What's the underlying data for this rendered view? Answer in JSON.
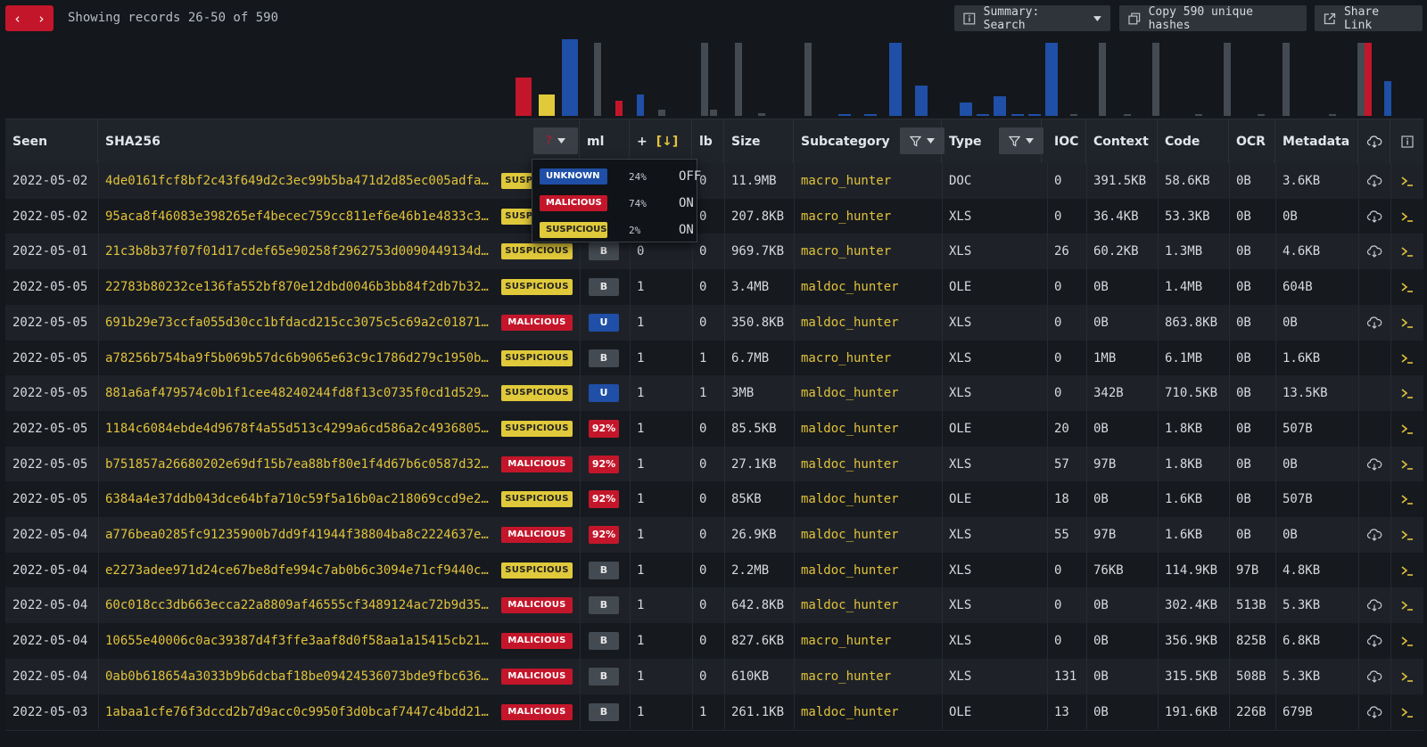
{
  "nav": {
    "prev": "‹",
    "next": "›"
  },
  "records_text": "Showing records 26-50 of 590",
  "toolbar": {
    "summary_label": "Summary: Search",
    "copy_label": "Copy 590 unique hashes",
    "share_label": "Share Link"
  },
  "colors": {
    "suspicious": "#e0c93a",
    "malicious": "#c4162a",
    "unknown": "#1f4fa6",
    "benign": "#444a52",
    "hash_text": "#e1c23c"
  },
  "columns": {
    "seen": "Seen",
    "sha256": "SHA256",
    "verdict_filter": "?",
    "ml": "ml",
    "plus": "+",
    "sort": "[↓]",
    "lb": "lb",
    "size": "Size",
    "subcategory": "Subcategory",
    "type": "Type",
    "ioc": "IOC",
    "context": "Context",
    "code": "Code",
    "ocr": "OCR",
    "metadata": "Metadata"
  },
  "verdict_popup": [
    {
      "label": "UNKNOWN",
      "percent": "24%",
      "state": "OFF",
      "color": "unknown"
    },
    {
      "label": "MALICIOUS",
      "percent": "74%",
      "state": "ON",
      "color": "malicious"
    },
    {
      "label": "SUSPICIOUS",
      "percent": "2%",
      "state": "ON",
      "color": "suspicious"
    }
  ],
  "rows": [
    {
      "seen": "2022-05-02",
      "hash": "4de0161fcf8bf2c43f649d2c3ec99b5ba471d2d85ec005adfa…",
      "verdict": "SUSPICIOUS",
      "ml": "",
      "plus": "",
      "lb": "0",
      "size": "11.9MB",
      "subcategory": "macro_hunter",
      "type": "DOC",
      "ioc": "0",
      "context": "391.5KB",
      "code": "58.6KB",
      "ocr": "0B",
      "metadata": "3.6KB",
      "download": true
    },
    {
      "seen": "2022-05-02",
      "hash": "95aca8f46083e398265ef4becec759cc811ef6e46b1e4833c3…",
      "verdict": "SUSPICIOUS",
      "ml": "",
      "plus": "",
      "lb": "0",
      "size": "207.8KB",
      "subcategory": "macro_hunter",
      "type": "XLS",
      "ioc": "0",
      "context": "36.4KB",
      "code": "53.3KB",
      "ocr": "0B",
      "metadata": "0B",
      "download": true
    },
    {
      "seen": "2022-05-01",
      "hash": "21c3b8b37f07f01d17cdef65e90258f2962753d0090449134d…",
      "verdict": "SUSPICIOUS",
      "ml": "B",
      "plus": "0",
      "lb": "0",
      "size": "969.7KB",
      "subcategory": "macro_hunter",
      "type": "XLS",
      "ioc": "26",
      "context": "60.2KB",
      "code": "1.3MB",
      "ocr": "0B",
      "metadata": "4.6KB",
      "download": true
    },
    {
      "seen": "2022-05-05",
      "hash": "22783b80232ce136fa552bf870e12dbd0046b3bb84f2db7b32…",
      "verdict": "SUSPICIOUS",
      "ml": "B",
      "plus": "1",
      "lb": "0",
      "size": "3.4MB",
      "subcategory": "maldoc_hunter",
      "type": "OLE",
      "ioc": "0",
      "context": "0B",
      "code": "1.4MB",
      "ocr": "0B",
      "metadata": "604B",
      "download": false
    },
    {
      "seen": "2022-05-05",
      "hash": "691b29e73ccfa055d30cc1bfdacd215cc3075c5c69a2c01871…",
      "verdict": "MALICIOUS",
      "ml": "U",
      "plus": "1",
      "lb": "0",
      "size": "350.8KB",
      "subcategory": "maldoc_hunter",
      "type": "XLS",
      "ioc": "0",
      "context": "0B",
      "code": "863.8KB",
      "ocr": "0B",
      "metadata": "0B",
      "download": true
    },
    {
      "seen": "2022-05-05",
      "hash": "a78256b754ba9f5b069b57dc6b9065e63c9c1786d279c1950b…",
      "verdict": "SUSPICIOUS",
      "ml": "B",
      "plus": "1",
      "lb": "1",
      "size": "6.7MB",
      "subcategory": "macro_hunter",
      "type": "XLS",
      "ioc": "0",
      "context": "1MB",
      "code": "6.1MB",
      "ocr": "0B",
      "metadata": "1.6KB",
      "download": false
    },
    {
      "seen": "2022-05-05",
      "hash": "881a6af479574c0b1f1cee48240244fd8f13c0735f0cd1d529…",
      "verdict": "SUSPICIOUS",
      "ml": "U",
      "plus": "1",
      "lb": "1",
      "size": "3MB",
      "subcategory": "maldoc_hunter",
      "type": "XLS",
      "ioc": "0",
      "context": "342B",
      "code": "710.5KB",
      "ocr": "0B",
      "metadata": "13.5KB",
      "download": false
    },
    {
      "seen": "2022-05-05",
      "hash": "1184c6084ebde4d9678f4a55d513c4299a6cd586a2c4936805…",
      "verdict": "SUSPICIOUS",
      "ml": "92%",
      "plus": "1",
      "lb": "0",
      "size": "85.5KB",
      "subcategory": "maldoc_hunter",
      "type": "OLE",
      "ioc": "20",
      "context": "0B",
      "code": "1.8KB",
      "ocr": "0B",
      "metadata": "507B",
      "download": false
    },
    {
      "seen": "2022-05-05",
      "hash": "b751857a26680202e69df15b7ea88bf80e1f4d67b6c0587d32…",
      "verdict": "MALICIOUS",
      "ml": "92%",
      "plus": "1",
      "lb": "0",
      "size": "27.1KB",
      "subcategory": "maldoc_hunter",
      "type": "XLS",
      "ioc": "57",
      "context": "97B",
      "code": "1.8KB",
      "ocr": "0B",
      "metadata": "0B",
      "download": true
    },
    {
      "seen": "2022-05-05",
      "hash": "6384a4e37ddb043dce64bfa710c59f5a16b0ac218069ccd9e2…",
      "verdict": "SUSPICIOUS",
      "ml": "92%",
      "plus": "1",
      "lb": "0",
      "size": "85KB",
      "subcategory": "maldoc_hunter",
      "type": "OLE",
      "ioc": "18",
      "context": "0B",
      "code": "1.6KB",
      "ocr": "0B",
      "metadata": "507B",
      "download": false
    },
    {
      "seen": "2022-05-04",
      "hash": "a776bea0285fc91235900b7dd9f41944f38804ba8c2224637e…",
      "verdict": "MALICIOUS",
      "ml": "92%",
      "plus": "1",
      "lb": "0",
      "size": "26.9KB",
      "subcategory": "maldoc_hunter",
      "type": "XLS",
      "ioc": "55",
      "context": "97B",
      "code": "1.6KB",
      "ocr": "0B",
      "metadata": "0B",
      "download": true
    },
    {
      "seen": "2022-05-04",
      "hash": "e2273adee971d24ce67be8dfe994c7ab0b6c3094e71cf9440c…",
      "verdict": "SUSPICIOUS",
      "ml": "B",
      "plus": "1",
      "lb": "0",
      "size": "2.2MB",
      "subcategory": "maldoc_hunter",
      "type": "XLS",
      "ioc": "0",
      "context": "76KB",
      "code": "114.9KB",
      "ocr": "97B",
      "metadata": "4.8KB",
      "download": false
    },
    {
      "seen": "2022-05-04",
      "hash": "60c018cc3db663ecca22a8809af46555cf3489124ac72b9d35…",
      "verdict": "MALICIOUS",
      "ml": "B",
      "plus": "1",
      "lb": "0",
      "size": "642.8KB",
      "subcategory": "maldoc_hunter",
      "type": "XLS",
      "ioc": "0",
      "context": "0B",
      "code": "302.4KB",
      "ocr": "513B",
      "metadata": "5.3KB",
      "download": true
    },
    {
      "seen": "2022-05-04",
      "hash": "10655e40006c0ac39387d4f3ffe3aaf8d0f58aa1a15415cb21…",
      "verdict": "MALICIOUS",
      "ml": "B",
      "plus": "1",
      "lb": "0",
      "size": "827.6KB",
      "subcategory": "macro_hunter",
      "type": "XLS",
      "ioc": "0",
      "context": "0B",
      "code": "356.9KB",
      "ocr": "825B",
      "metadata": "6.8KB",
      "download": true
    },
    {
      "seen": "2022-05-04",
      "hash": "0ab0b618654a3033b9b6dcbaf18be09424536073bde9fbc636…",
      "verdict": "MALICIOUS",
      "ml": "B",
      "plus": "1",
      "lb": "0",
      "size": "610KB",
      "subcategory": "macro_hunter",
      "type": "XLS",
      "ioc": "131",
      "context": "0B",
      "code": "315.5KB",
      "ocr": "508B",
      "metadata": "5.3KB",
      "download": true
    },
    {
      "seen": "2022-05-03",
      "hash": "1abaa1cfe76f3dccd2b7d9acc0c9950f3d0bcaf7447c4bdd21…",
      "verdict": "MALICIOUS",
      "ml": "B",
      "plus": "1",
      "lb": "1",
      "size": "261.1KB",
      "subcategory": "maldoc_hunter",
      "type": "OLE",
      "ioc": "13",
      "context": "0B",
      "code": "191.6KB",
      "ocr": "226B",
      "metadata": "679B",
      "download": true
    }
  ],
  "histograms": [
    {
      "column": "verdict",
      "bars": [
        {
          "color": "malicious",
          "value": 0.5
        },
        {
          "color": "suspicious",
          "value": 0.28
        },
        {
          "color": "unknown",
          "value": 1.0
        }
      ]
    },
    {
      "column": "ml",
      "bars": [
        {
          "color": "benign",
          "value": 0.95
        },
        {
          "color": "malicious",
          "value": 0.2
        },
        {
          "color": "unknown",
          "value": 0.28
        }
      ]
    },
    {
      "column": "plus",
      "bars": [
        {
          "color": "benign",
          "value": 0.08
        },
        {
          "color": "benign",
          "value": 0.95
        }
      ]
    },
    {
      "column": "lb",
      "bars": [
        {
          "color": "benign",
          "value": 0.08
        },
        {
          "color": "benign",
          "value": 0.95
        }
      ]
    },
    {
      "column": "size",
      "bars": [
        {
          "color": "benign",
          "value": 0.03
        },
        {
          "color": "benign",
          "value": 0.95
        }
      ]
    },
    {
      "column": "subcategory",
      "bars": [
        {
          "color": "unknown",
          "value": 0.02
        },
        {
          "color": "unknown",
          "value": 0.02
        },
        {
          "color": "unknown",
          "value": 0.95
        },
        {
          "color": "unknown",
          "value": 0.4
        }
      ]
    },
    {
      "column": "type",
      "bars": [
        {
          "color": "unknown",
          "value": 0.18
        },
        {
          "color": "unknown",
          "value": 0.02
        },
        {
          "color": "unknown",
          "value": 0.26
        },
        {
          "color": "unknown",
          "value": 0.02
        },
        {
          "color": "unknown",
          "value": 0.02
        },
        {
          "color": "unknown",
          "value": 0.95
        }
      ]
    },
    {
      "column": "ioc",
      "bars": [
        {
          "color": "benign",
          "value": 0.02
        },
        {
          "color": "benign",
          "value": 0.95
        }
      ]
    },
    {
      "column": "context",
      "bars": [
        {
          "color": "benign",
          "value": 0.02
        },
        {
          "color": "benign",
          "value": 0.95
        }
      ]
    },
    {
      "column": "code",
      "bars": [
        {
          "color": "benign",
          "value": 0.02
        },
        {
          "color": "benign",
          "value": 0.95
        }
      ]
    },
    {
      "column": "ocr",
      "bars": [
        {
          "color": "benign",
          "value": 0.02
        },
        {
          "color": "benign",
          "value": 0.95
        }
      ]
    },
    {
      "column": "metadata",
      "bars": [
        {
          "color": "benign",
          "value": 0.02
        },
        {
          "color": "benign",
          "value": 0.95
        }
      ]
    },
    {
      "column": "download",
      "bars": [
        {
          "color": "malicious",
          "value": 0.95
        },
        {
          "color": "unknown",
          "value": 0.45
        }
      ]
    }
  ],
  "icons": {
    "summary": "info-icon",
    "copy": "copy-icon",
    "share": "share-icon",
    "filter": "filter-icon",
    "caret": "caret-down-icon",
    "download": "cloud-download-icon",
    "terminal": "terminal-icon",
    "info_col": "info-icon"
  }
}
